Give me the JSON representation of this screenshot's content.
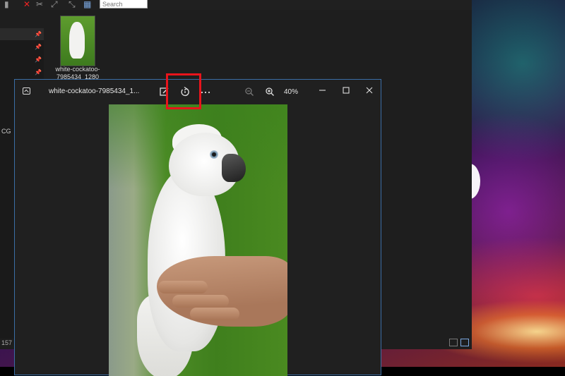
{
  "explorer": {
    "search_placeholder": "Search",
    "thumbnail": {
      "filename_line1": "white-cockatoo-",
      "filename_line2": "7985434_1280"
    },
    "nav_label": "CG",
    "status_count": "157"
  },
  "viewer": {
    "title": "white-cockatoo-7985434_1...",
    "zoom_level": "40%",
    "toolbar": {
      "edit": "edit-image-icon",
      "rotate": "rotate-icon",
      "more": "more-options-icon",
      "zoom_out": "zoom-out-icon",
      "zoom_in": "zoom-in-icon"
    },
    "window_controls": [
      "minimize-icon",
      "maximize-icon",
      "close-icon"
    ]
  },
  "colors": {
    "highlight": "#e8141b",
    "window_border": "#3b6ea5",
    "window_bg": "#202020"
  }
}
